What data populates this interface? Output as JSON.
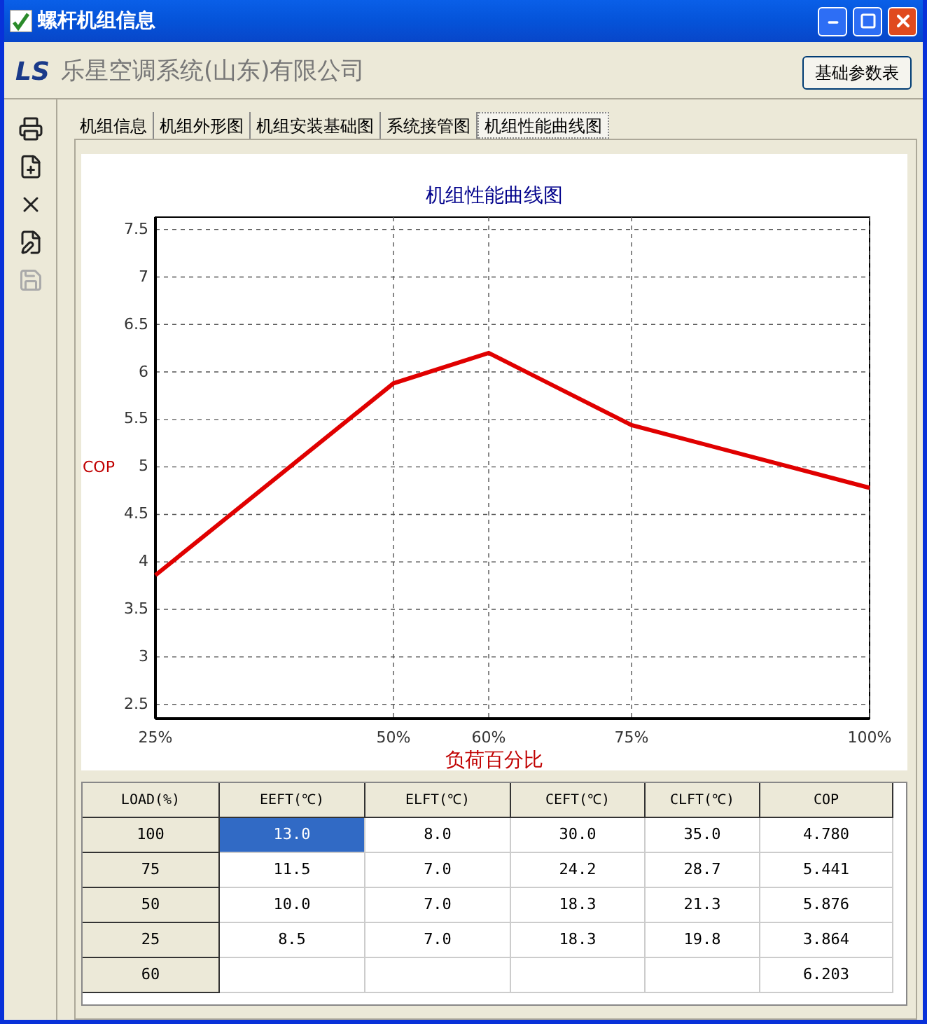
{
  "window": {
    "title": "螺杆机组信息"
  },
  "header": {
    "logo": "LS",
    "company": "乐星空调系统(山东)有限公司",
    "button": "基础参数表"
  },
  "toolbar": [
    {
      "kind": "print",
      "disabled": false
    },
    {
      "kind": "new",
      "disabled": false
    },
    {
      "kind": "delete",
      "disabled": false
    },
    {
      "kind": "edit",
      "disabled": false
    },
    {
      "kind": "save",
      "disabled": true
    }
  ],
  "tabs": [
    {
      "label": "机组信息",
      "selected": false
    },
    {
      "label": "机组外形图",
      "selected": false
    },
    {
      "label": "机组安装基础图",
      "selected": false
    },
    {
      "label": "系统接管图",
      "selected": false
    },
    {
      "label": "机组性能曲线图",
      "selected": true
    }
  ],
  "chart": {
    "chart_data": {
      "type": "line",
      "title": "机组性能曲线图",
      "xlabel": "负荷百分比",
      "ylabel": "COP",
      "x": [
        25,
        50,
        60,
        75,
        100
      ],
      "series": [
        {
          "color": "#e00000",
          "values": [
            3.86,
            5.88,
            6.2,
            5.44,
            4.78
          ]
        }
      ],
      "grid": true,
      "xlim": [
        25,
        100
      ],
      "ylim": [
        2.35,
        7.63
      ],
      "xticks": [
        {
          "value": 25,
          "label": "25%"
        },
        {
          "value": 50,
          "label": "50%"
        },
        {
          "value": 60,
          "label": "60%"
        },
        {
          "value": 75,
          "label": "75%"
        },
        {
          "value": 100,
          "label": "100%"
        }
      ],
      "yticks": [
        {
          "value": 2.5,
          "label": "2.5"
        },
        {
          "value": 3,
          "label": "3"
        },
        {
          "value": 3.5,
          "label": "3.5"
        },
        {
          "value": 4,
          "label": "4"
        },
        {
          "value": 4.5,
          "label": "4.5"
        },
        {
          "value": 5,
          "label": "5"
        },
        {
          "value": 5.5,
          "label": "5.5"
        },
        {
          "value": 6,
          "label": "6"
        },
        {
          "value": 6.5,
          "label": "6.5"
        },
        {
          "value": 7,
          "label": "7"
        },
        {
          "value": 7.5,
          "label": "7.5"
        }
      ]
    }
  },
  "table": {
    "columns": [
      "LOAD(%)",
      "EEFT(℃)",
      "ELFT(℃)",
      "CEFT(℃)",
      "CLFT(℃)",
      "COP"
    ],
    "rows": [
      {
        "cells": [
          {
            "text": "100",
            "selected": false
          },
          {
            "text": "13.0",
            "selected": true
          },
          {
            "text": "8.0",
            "selected": false
          },
          {
            "text": "30.0",
            "selected": false
          },
          {
            "text": "35.0",
            "selected": false
          },
          {
            "text": "4.780",
            "selected": false
          }
        ]
      },
      {
        "cells": [
          {
            "text": "75",
            "selected": false
          },
          {
            "text": "11.5",
            "selected": false
          },
          {
            "text": "7.0",
            "selected": false
          },
          {
            "text": "24.2",
            "selected": false
          },
          {
            "text": "28.7",
            "selected": false
          },
          {
            "text": "5.441",
            "selected": false
          }
        ]
      },
      {
        "cells": [
          {
            "text": "50",
            "selected": false
          },
          {
            "text": "10.0",
            "selected": false
          },
          {
            "text": "7.0",
            "selected": false
          },
          {
            "text": "18.3",
            "selected": false
          },
          {
            "text": "21.3",
            "selected": false
          },
          {
            "text": "5.876",
            "selected": false
          }
        ]
      },
      {
        "cells": [
          {
            "text": "25",
            "selected": false
          },
          {
            "text": "8.5",
            "selected": false
          },
          {
            "text": "7.0",
            "selected": false
          },
          {
            "text": "18.3",
            "selected": false
          },
          {
            "text": "19.8",
            "selected": false
          },
          {
            "text": "3.864",
            "selected": false
          }
        ]
      },
      {
        "cells": [
          {
            "text": "60",
            "selected": false
          },
          {
            "text": "",
            "selected": false
          },
          {
            "text": "",
            "selected": false
          },
          {
            "text": "",
            "selected": false
          },
          {
            "text": "",
            "selected": false
          },
          {
            "text": "6.203",
            "selected": false
          }
        ]
      }
    ]
  }
}
